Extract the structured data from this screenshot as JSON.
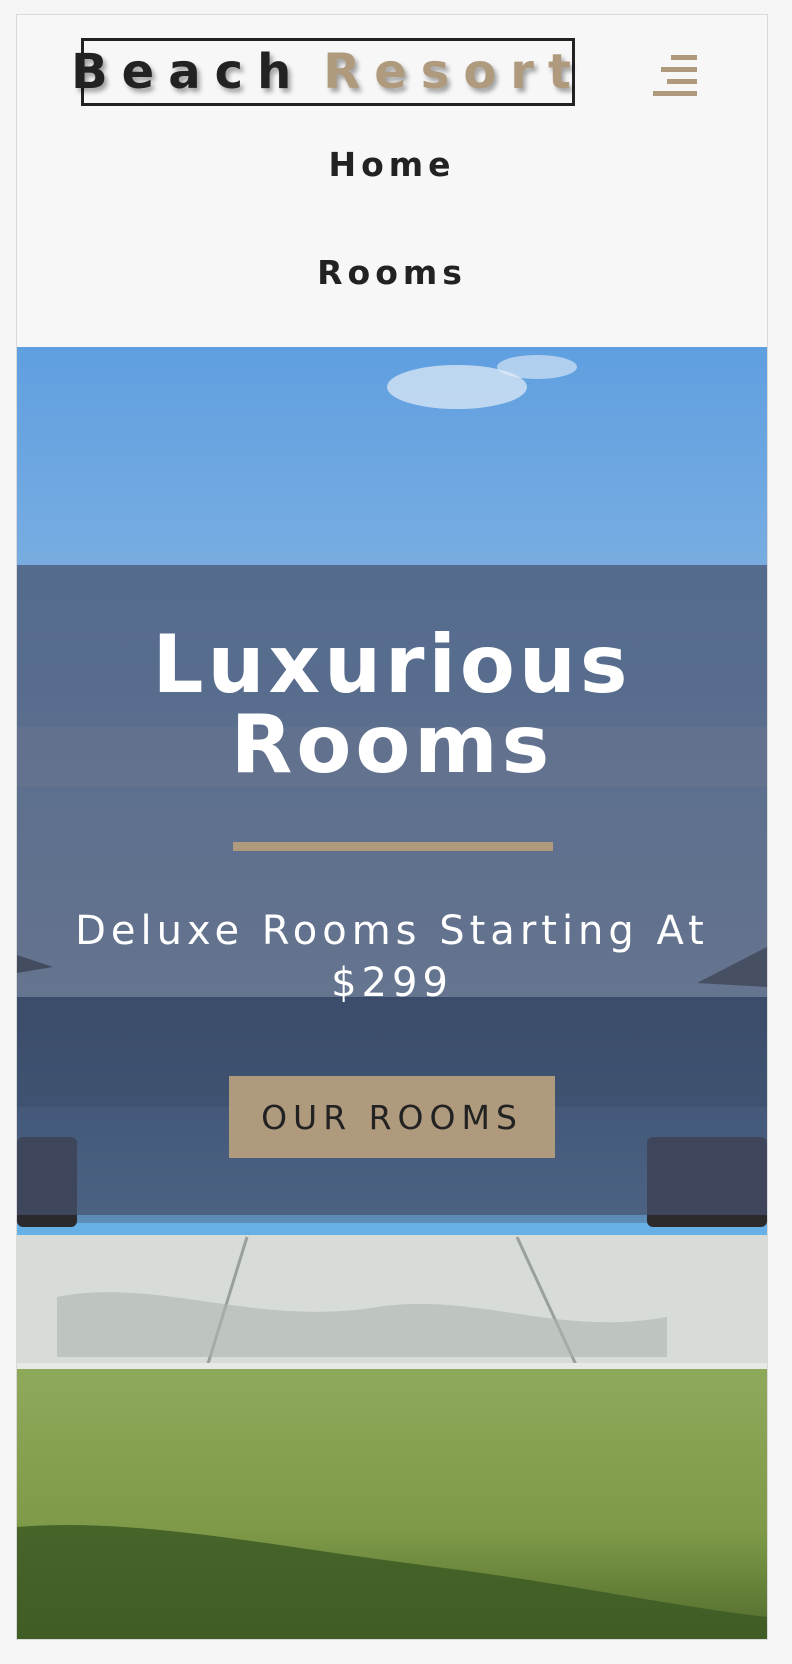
{
  "brand": {
    "word1": "Beach",
    "word2": "Resort",
    "accent_color": "#af9a7d",
    "text_color": "#222222"
  },
  "nav": {
    "menu_icon": "menu-bars-icon",
    "links": [
      {
        "label": "Home"
      },
      {
        "label": "Rooms"
      }
    ]
  },
  "hero": {
    "background": "beach resort infinity pool, ocean, lawn (photo)",
    "title": "Luxurious Rooms",
    "subtitle": "Deluxe Rooms Starting At $299",
    "button_label": "Our Rooms"
  }
}
